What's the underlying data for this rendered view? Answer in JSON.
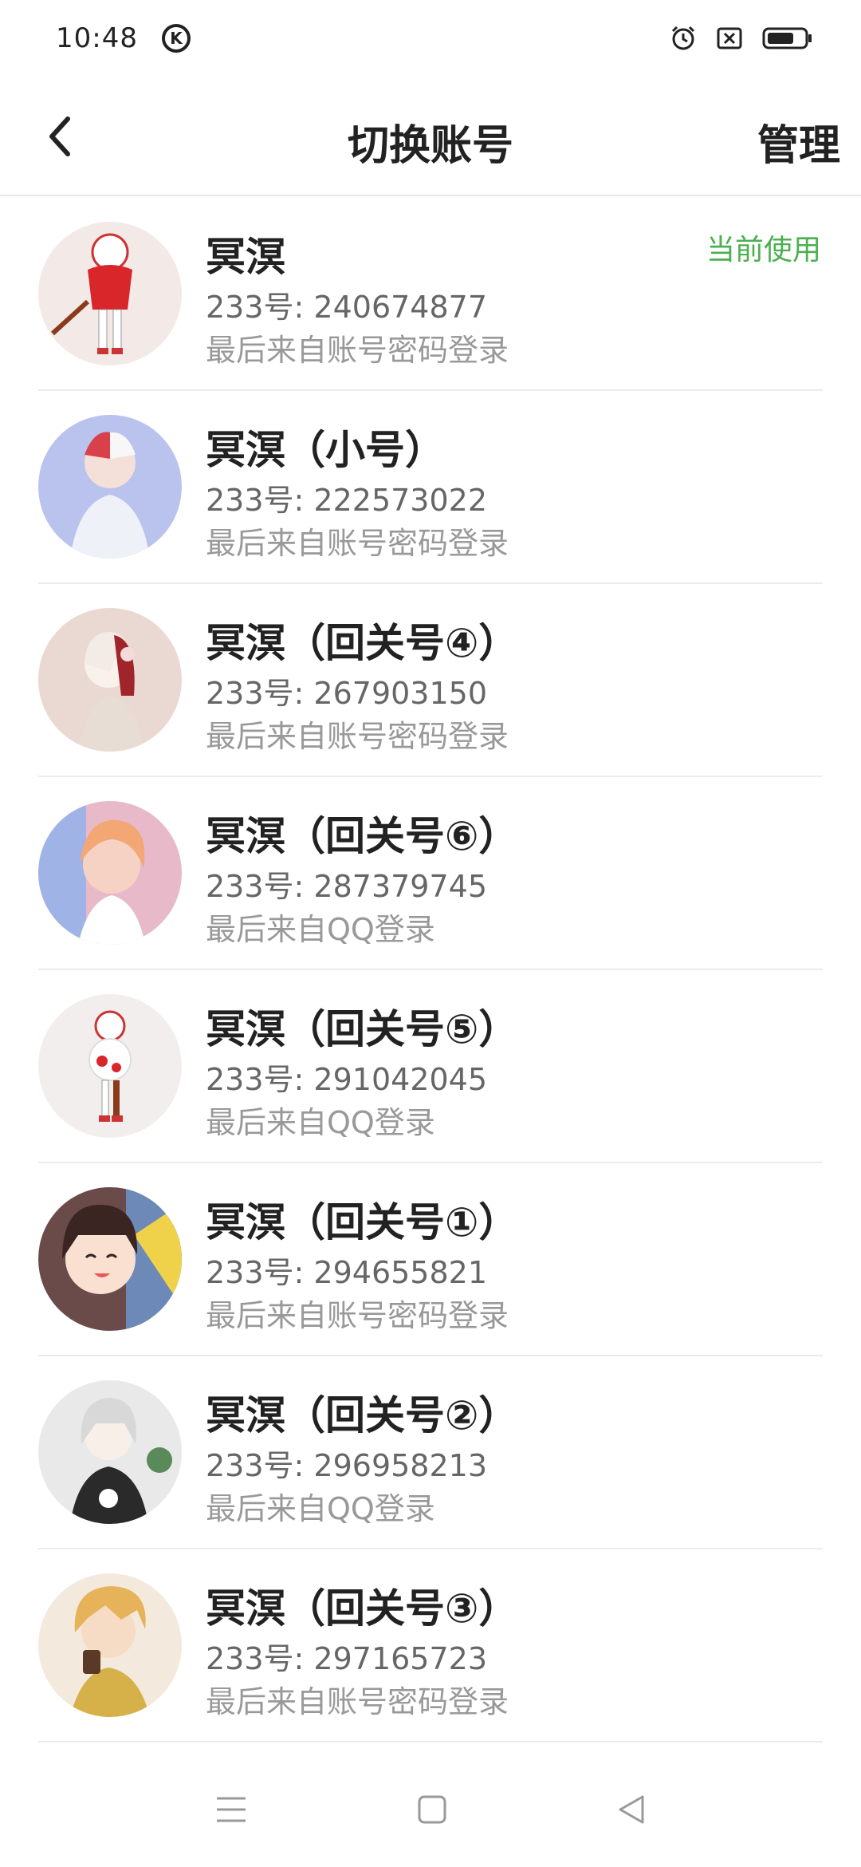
{
  "status_bar": {
    "time": "10:48",
    "k_badge": "K",
    "icons": [
      "alarm-icon",
      "sim-off-icon",
      "battery-icon"
    ]
  },
  "nav": {
    "back_icon": "chevron-left-icon",
    "title": "切换账号",
    "manage_label": "管理"
  },
  "accounts": [
    {
      "name": "冥溟",
      "id": "233号: 240674877",
      "login": "最后来自账号密码登录",
      "current": "当前使用",
      "avatar_color": "#f3e9e6"
    },
    {
      "name": "冥溟（小号）",
      "id": "233号: 222573022",
      "login": "最后来自账号密码登录",
      "avatar_color": "#b9c3ee"
    },
    {
      "name": "冥溟（回关号④）",
      "id": "233号: 267903150",
      "login": "最后来自账号密码登录",
      "avatar_color": "#e9d9d2"
    },
    {
      "name": "冥溟（回关号⑥）",
      "id": "233号: 287379745",
      "login": "最后来自QQ登录",
      "avatar_color": "#e8b9c9"
    },
    {
      "name": "冥溟（回关号⑤）",
      "id": "233号: 291042045",
      "login": "最后来自QQ登录",
      "avatar_color": "#f3eeee"
    },
    {
      "name": "冥溟（回关号①）",
      "id": "233号: 294655821",
      "login": "最后来自账号密码登录",
      "avatar_color": "#6a4b4a"
    },
    {
      "name": "冥溟（回关号②）",
      "id": "233号: 296958213",
      "login": "最后来自QQ登录",
      "avatar_color": "#2a2a2a"
    },
    {
      "name": "冥溟（回关号③）",
      "id": "233号: 297165723",
      "login": "最后来自账号密码登录",
      "avatar_color": "#d6b14a"
    }
  ],
  "accent_color": "#4caf50",
  "bottom_nav": {
    "icons": [
      "menu-icon",
      "home-square-icon",
      "back-triangle-icon"
    ]
  }
}
